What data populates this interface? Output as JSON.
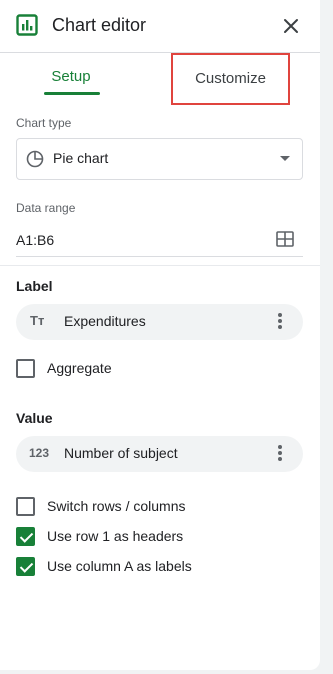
{
  "header": {
    "title": "Chart editor"
  },
  "tabs": {
    "setup": "Setup",
    "customize": "Customize"
  },
  "chart_type": {
    "label": "Chart type",
    "value": "Pie chart"
  },
  "data_range": {
    "label": "Data range",
    "value": "A1:B6"
  },
  "label_section": {
    "heading": "Label",
    "chip_icon": "Tт",
    "chip_text": "Expenditures"
  },
  "aggregate": {
    "label": "Aggregate",
    "checked": false
  },
  "value_section": {
    "heading": "Value",
    "chip_icon": "123",
    "chip_text": "Number of subject"
  },
  "options": [
    {
      "label": "Switch rows / columns",
      "checked": false
    },
    {
      "label": "Use row 1 as headers",
      "checked": true
    },
    {
      "label": "Use column A as labels",
      "checked": true
    }
  ],
  "colors": {
    "accent": "#188038",
    "highlight_border": "#e0443e"
  }
}
